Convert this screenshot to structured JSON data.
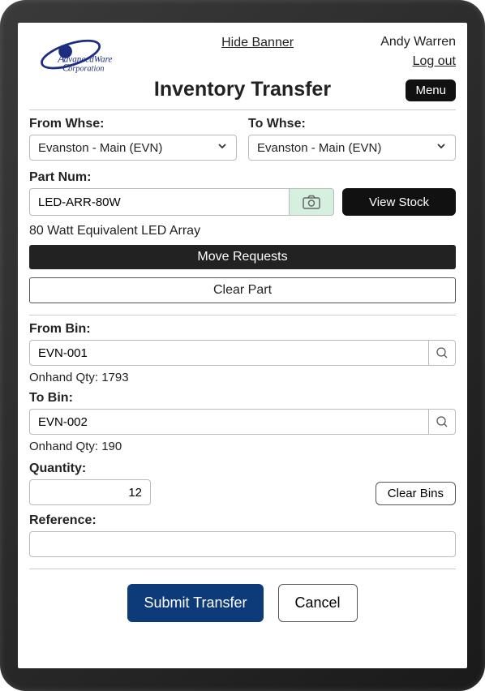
{
  "header": {
    "hide_banner": "Hide Banner",
    "user_name": "Andy Warren",
    "logout": "Log out",
    "title": "Inventory Transfer",
    "menu": "Menu"
  },
  "warehouse": {
    "from_label": "From Whse:",
    "from_value": "Evanston - Main (EVN)",
    "to_label": "To Whse:",
    "to_value": "Evanston - Main (EVN)"
  },
  "part": {
    "label": "Part Num:",
    "value": "LED-ARR-80W",
    "view_stock": "View Stock",
    "description": "80 Watt Equivalent LED Array",
    "move_requests": "Move Requests",
    "clear_part": "Clear Part"
  },
  "bins": {
    "from_label": "From Bin:",
    "from_value": "EVN-001",
    "from_onhand": "Onhand Qty: 1793",
    "to_label": "To Bin:",
    "to_value": "EVN-002",
    "to_onhand": "Onhand Qty: 190"
  },
  "quantity": {
    "label": "Quantity:",
    "value": "12",
    "clear_bins": "Clear Bins"
  },
  "reference": {
    "label": "Reference:",
    "value": ""
  },
  "actions": {
    "submit": "Submit Transfer",
    "cancel": "Cancel"
  }
}
